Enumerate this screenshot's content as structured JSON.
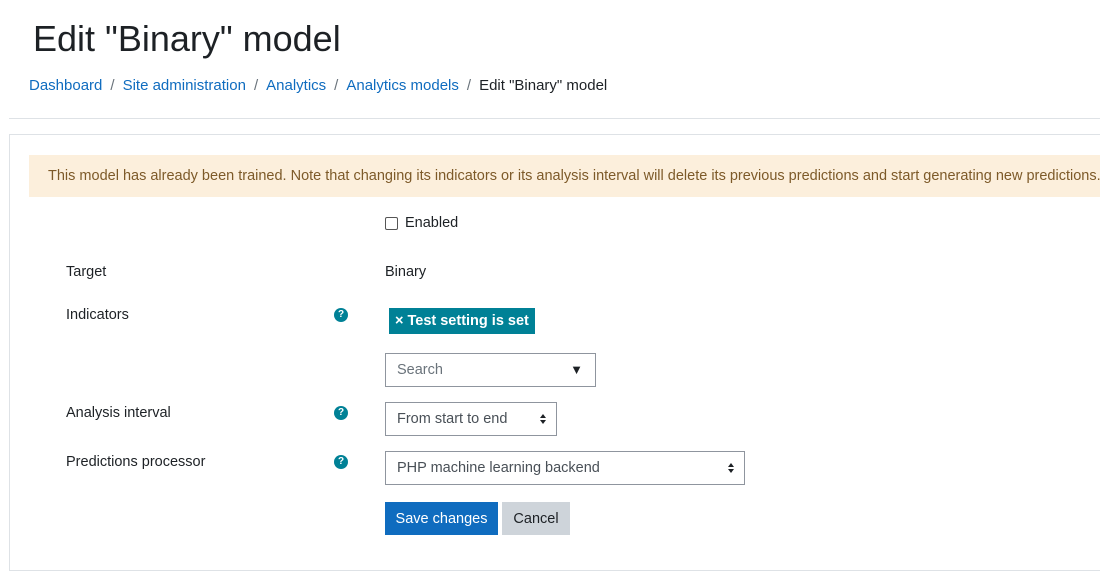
{
  "page": {
    "title": "Edit \"Binary\" model"
  },
  "breadcrumb": {
    "items": [
      "Dashboard",
      "Site administration",
      "Analytics",
      "Analytics models"
    ],
    "current": "Edit \"Binary\" model",
    "separator": "/"
  },
  "alert": {
    "text": "This model has already been trained. Note that changing its indicators or its analysis interval will delete its previous predictions and start generating new predictions."
  },
  "form": {
    "enabled_label": "Enabled",
    "enabled_checked": false,
    "target_label": "Target",
    "target_value": "Binary",
    "indicators_label": "Indicators",
    "indicator_tag": "Test setting is set",
    "indicator_tag_remove": "×",
    "search_placeholder": "Search",
    "search_caret": "▼",
    "analysis_interval_label": "Analysis interval",
    "analysis_interval_value": "From start to end",
    "predictions_processor_label": "Predictions processor",
    "predictions_processor_value": "PHP machine learning backend",
    "help_glyph": "?",
    "save_label": "Save changes",
    "cancel_label": "Cancel"
  },
  "colors": {
    "link": "#0f6cbf",
    "primary_button": "#0f6cbf",
    "tag_bg": "#008196",
    "help_icon": "#008196",
    "alert_bg": "#fcefdc",
    "alert_text": "#7d5a29"
  }
}
